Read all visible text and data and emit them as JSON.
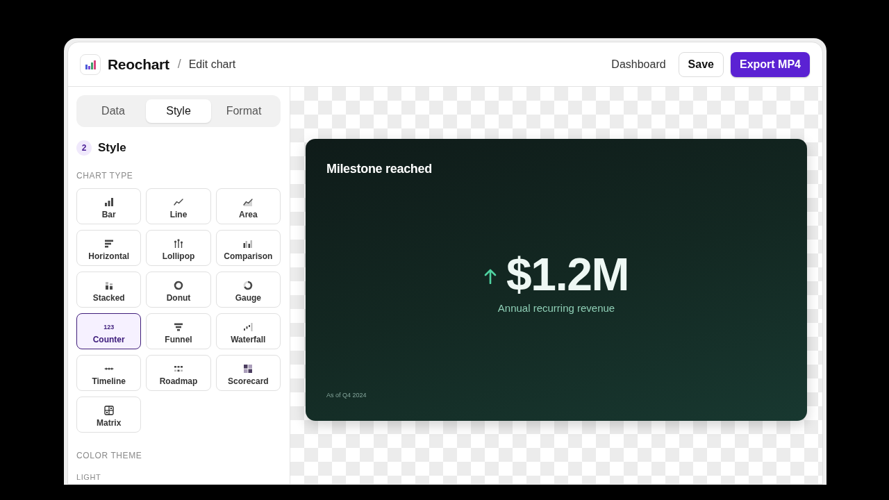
{
  "header": {
    "app_name": "Reochart",
    "separator": "/",
    "page_title": "Edit chart",
    "actions": [
      {
        "label": "Dashboard",
        "kind": "link"
      },
      {
        "label": "Save",
        "kind": "secondary"
      },
      {
        "label": "Export MP4",
        "kind": "primary"
      }
    ]
  },
  "sidebar": {
    "tabs": [
      {
        "label": "Data",
        "selected": false
      },
      {
        "label": "Style",
        "selected": true
      },
      {
        "label": "Format",
        "selected": false
      }
    ],
    "step": {
      "number": "2",
      "title": "Style"
    },
    "chart_type_heading": "CHART TYPE",
    "chart_types": [
      {
        "label": "Bar",
        "selected": false
      },
      {
        "label": "Line",
        "selected": false
      },
      {
        "label": "Area",
        "selected": false
      },
      {
        "label": "Horizontal",
        "selected": false
      },
      {
        "label": "Lollipop",
        "selected": false
      },
      {
        "label": "Comparison",
        "selected": false
      },
      {
        "label": "Stacked",
        "selected": false
      },
      {
        "label": "Donut",
        "selected": false
      },
      {
        "label": "Gauge",
        "selected": false
      },
      {
        "label": "Counter",
        "selected": true,
        "icon_text": "123"
      },
      {
        "label": "Funnel",
        "selected": false
      },
      {
        "label": "Waterfall",
        "selected": false
      },
      {
        "label": "Timeline",
        "selected": false
      },
      {
        "label": "Roadmap",
        "selected": false
      },
      {
        "label": "Scorecard",
        "selected": false
      },
      {
        "label": "Matrix",
        "selected": false
      }
    ],
    "color_theme_heading": "COLOR THEME",
    "theme_group_heading": "LIGHT"
  },
  "preview": {
    "title": "Milestone reached",
    "value": "$1.2M",
    "caption": "Annual recurring revenue",
    "footnote": "As of Q4 2024"
  }
}
